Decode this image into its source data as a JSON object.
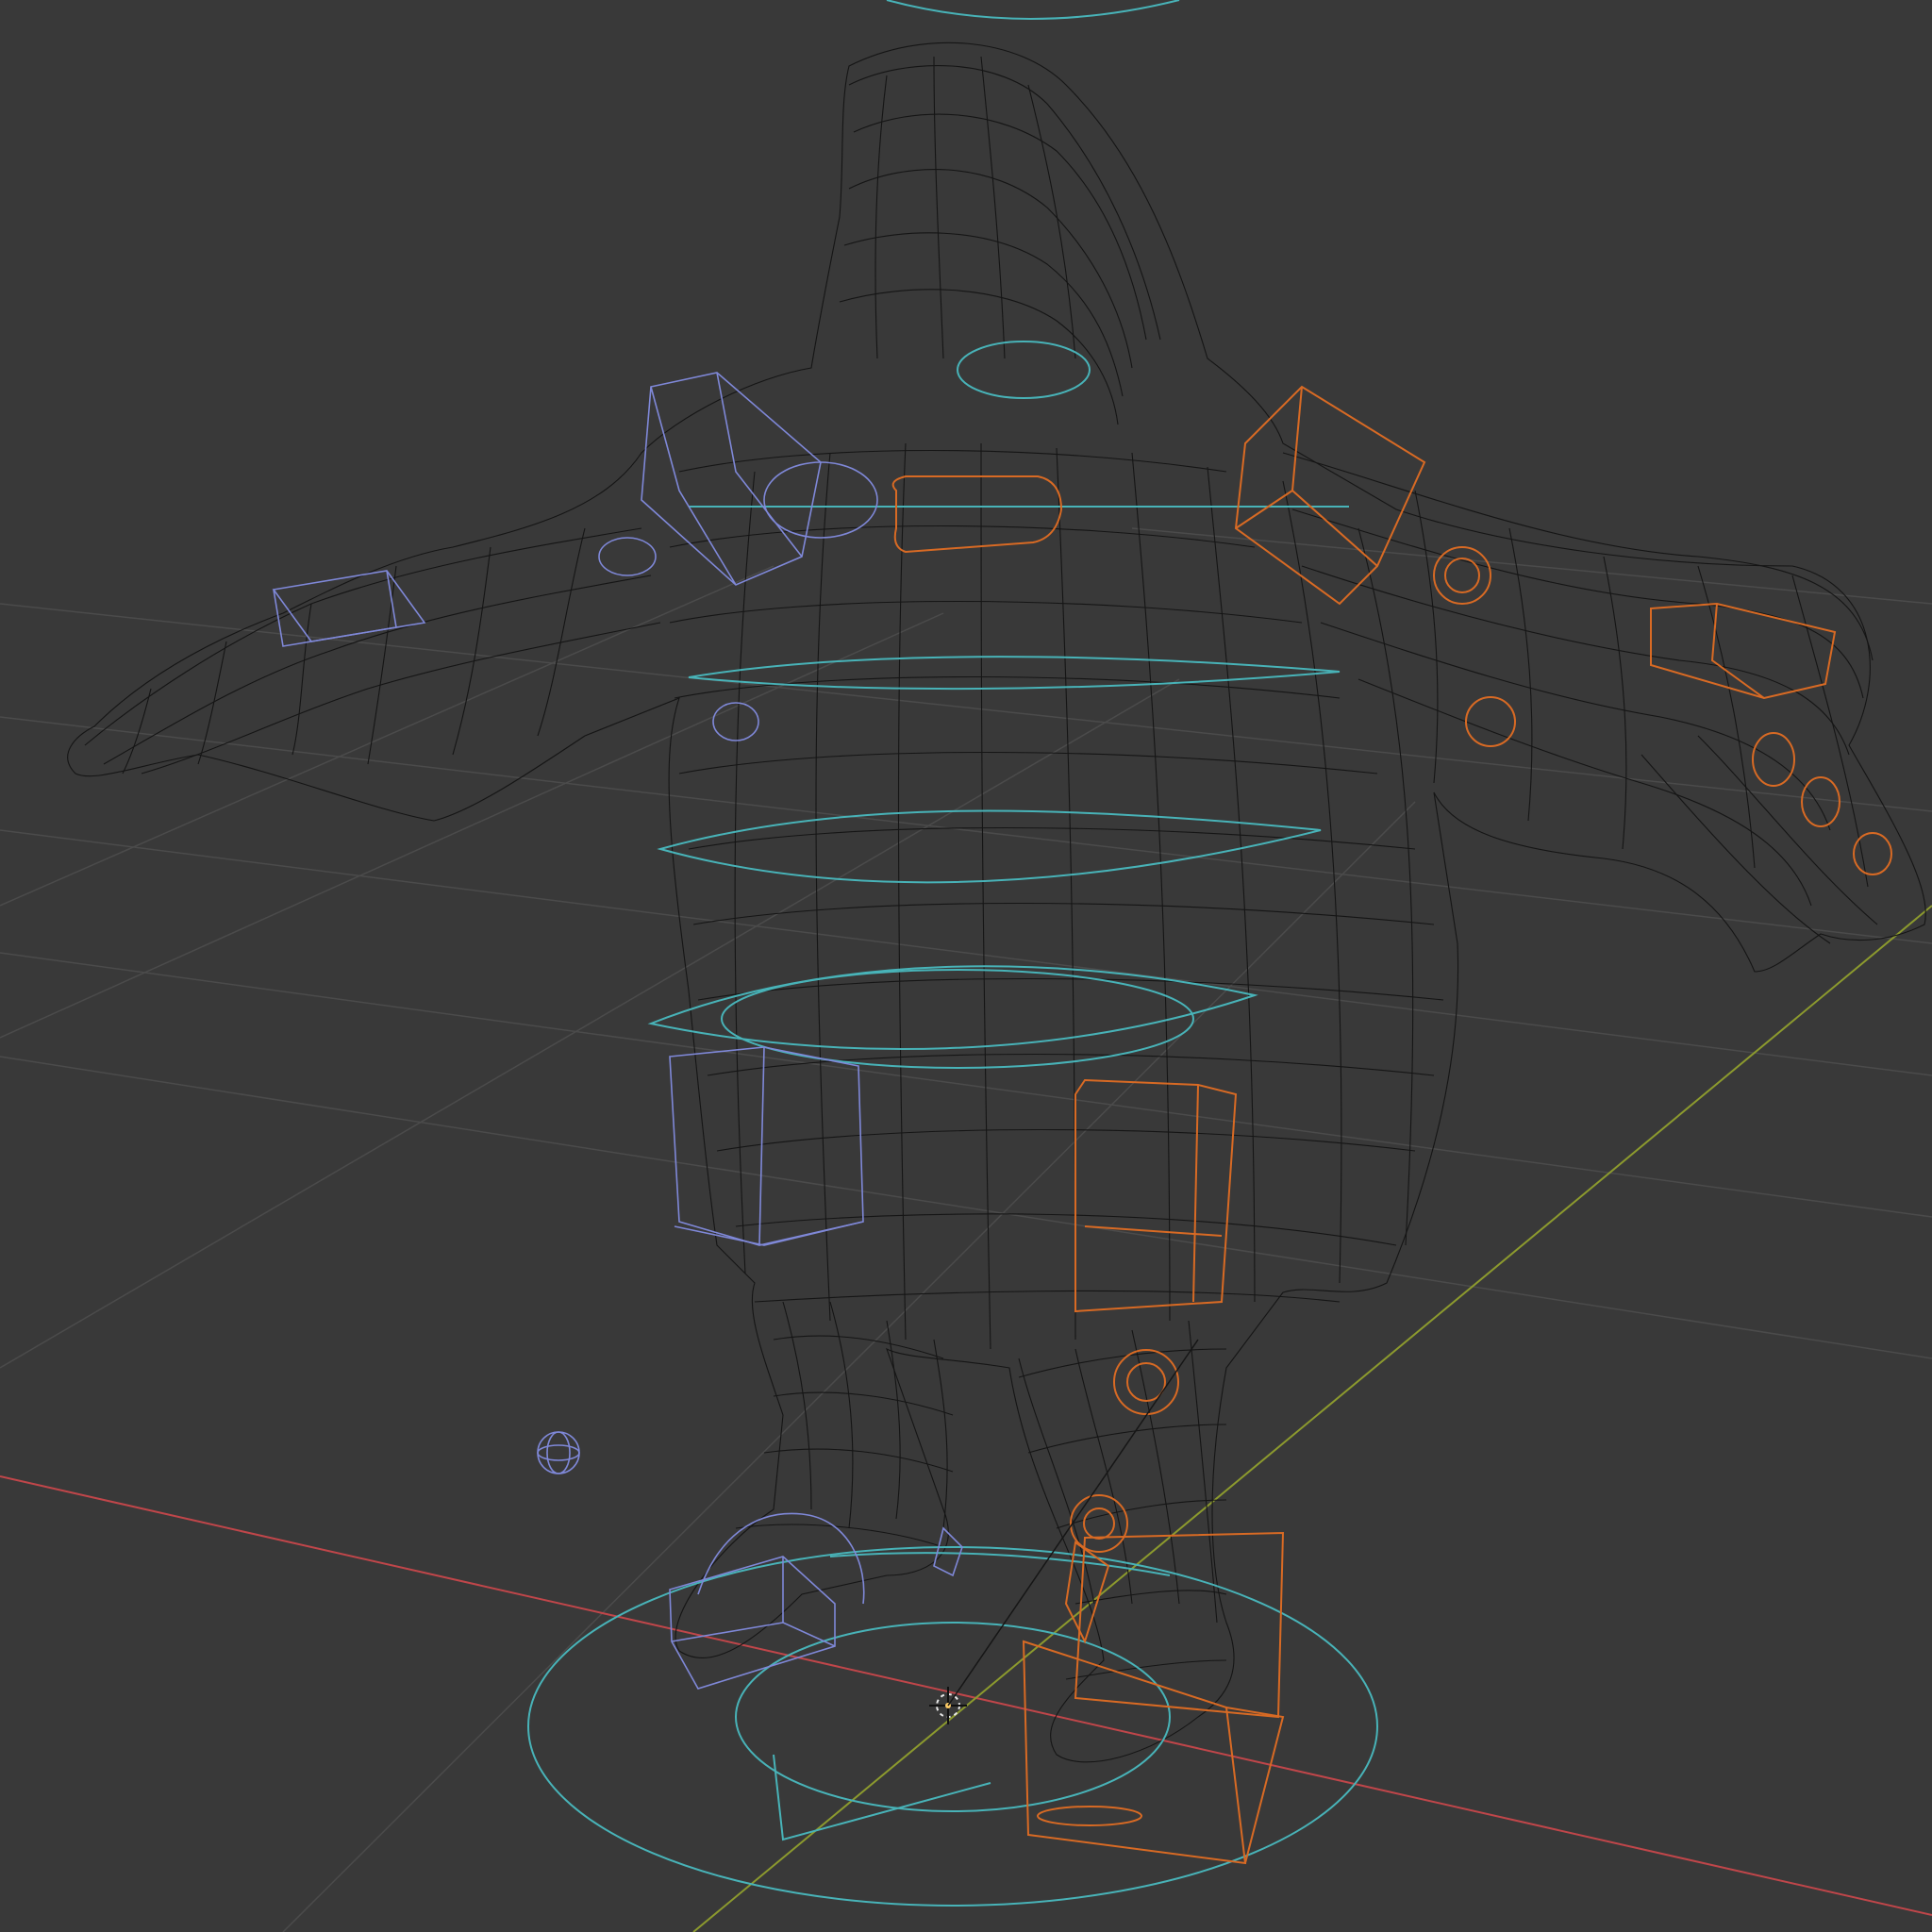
{
  "viewport": {
    "mode": "wireframe",
    "background": "#393939",
    "colors": {
      "grid": "#4b4b4b",
      "x_axis": "#c0464a",
      "y_axis": "#8c9a2e",
      "mesh_wire": "#151515",
      "controls_center": "#48b3b8",
      "controls_left": "#7f88d8",
      "controls_right": "#d86a24"
    }
  },
  "scene": {
    "objects": [
      {
        "name": "character-mesh",
        "icon": "wireframe-mesh"
      },
      {
        "name": "rig-controls-center",
        "icon": "circle-controls"
      },
      {
        "name": "rig-controls-left",
        "icon": "box-controls"
      },
      {
        "name": "rig-controls-right",
        "icon": "box-controls"
      },
      {
        "name": "3d-cursor",
        "icon": "crosshair"
      },
      {
        "name": "light-empty",
        "icon": "sphere-empty"
      }
    ]
  }
}
